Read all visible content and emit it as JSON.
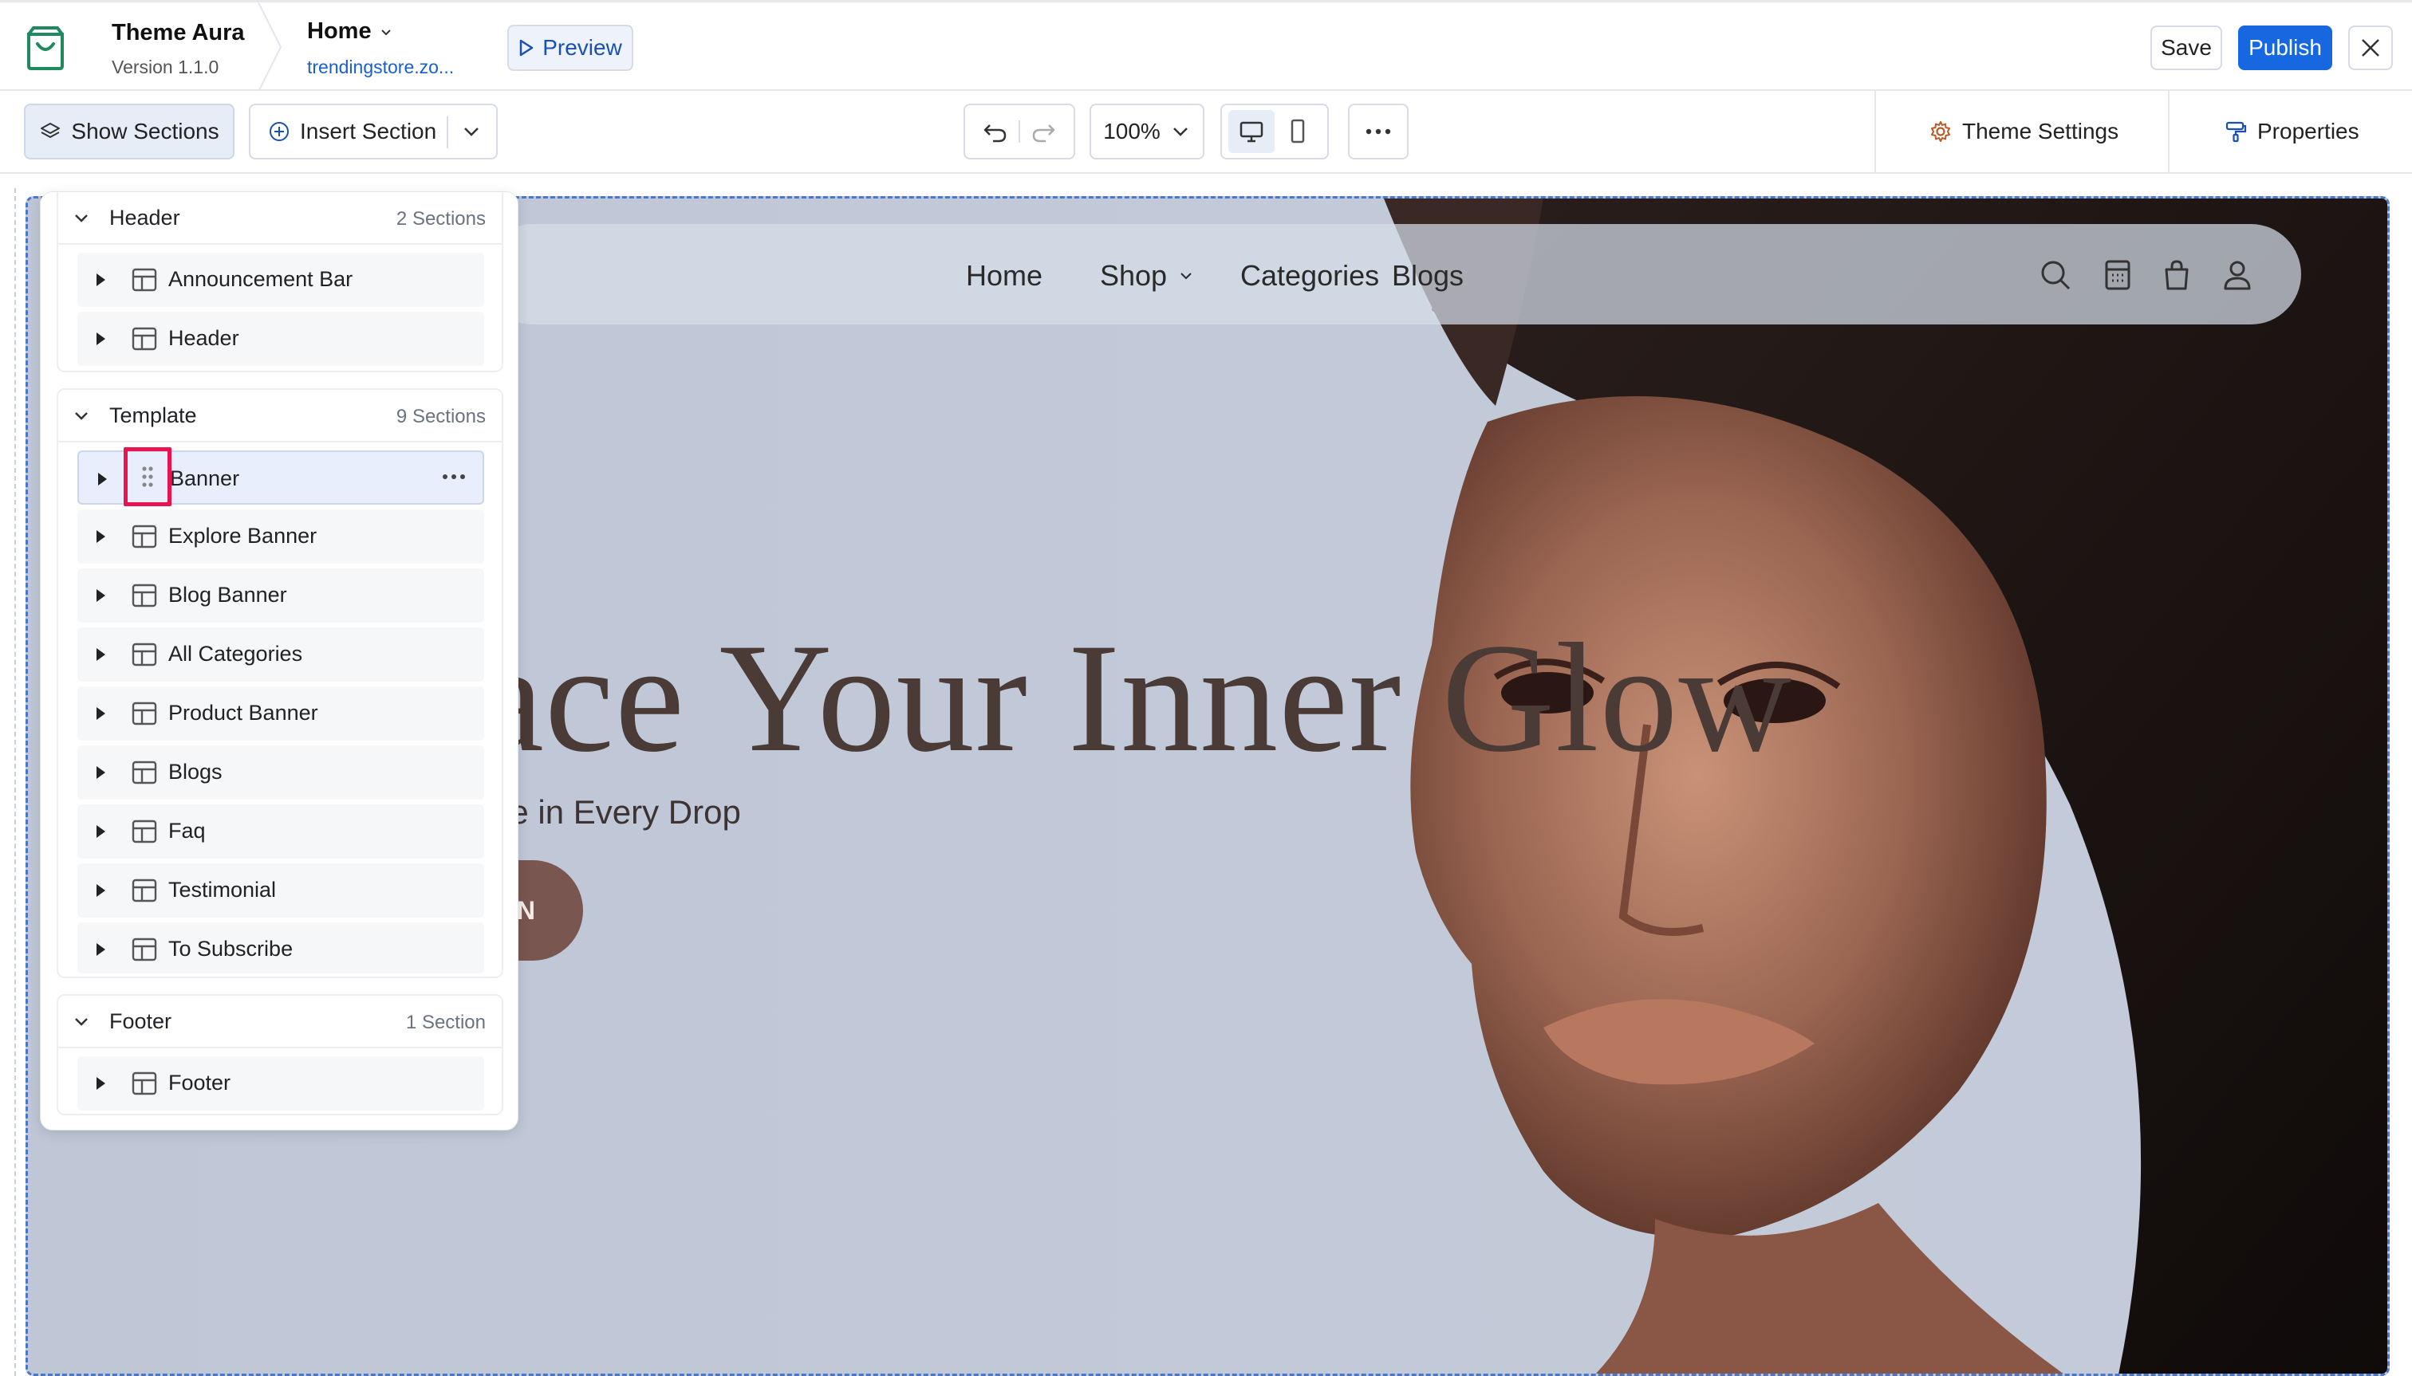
{
  "topbar": {
    "theme_name": "Theme Aura",
    "version": "Version 1.1.0",
    "page_name": "Home",
    "page_url": "trendingstore.zo...",
    "preview_label": "Preview",
    "save_label": "Save",
    "publish_label": "Publish"
  },
  "toolbar": {
    "show_sections_label": "Show Sections",
    "insert_section_label": "Insert Section",
    "zoom": "100%",
    "theme_settings_label": "Theme Settings",
    "properties_label": "Properties"
  },
  "site": {
    "nav": [
      "Home",
      "Shop",
      "Categories",
      "Blogs"
    ],
    "hero_title": "ace Your Inner Glow",
    "hero_subtitle": "nce in Every Drop",
    "hero_cta": "N"
  },
  "panel": {
    "groups": [
      {
        "name": "Header",
        "count": "2 Sections",
        "items": [
          "Announcement Bar",
          "Header"
        ]
      },
      {
        "name": "Template",
        "count": "9 Sections",
        "items": [
          "Banner",
          "Explore Banner",
          "Blog Banner",
          "All Categories",
          "Product Banner",
          "Blogs",
          "Faq",
          "Testimonial",
          "To Subscribe"
        ]
      },
      {
        "name": "Footer",
        "count": "1 Section",
        "items": [
          "Footer"
        ]
      }
    ],
    "selected_item": "Banner"
  },
  "colors": {
    "primary": "#1667e0",
    "highlight": "#e8134f",
    "hero_bg": "#c0c8d8",
    "cta": "#7a5650"
  }
}
